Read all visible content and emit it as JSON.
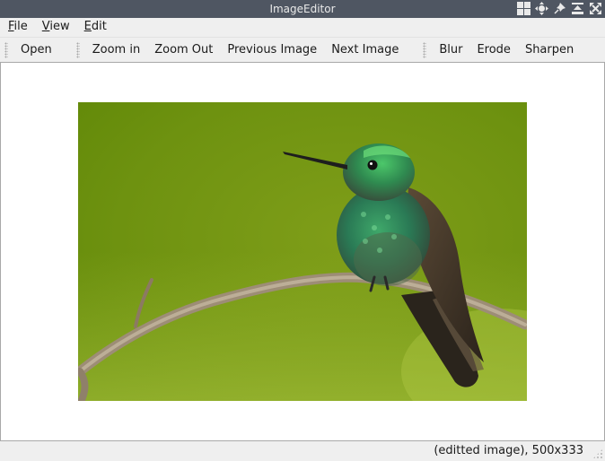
{
  "window": {
    "title": "ImageEditor",
    "title_icons": [
      "tile-icon",
      "move-icon",
      "pin-icon",
      "minimize-icon",
      "close-icon"
    ]
  },
  "menubar": {
    "file": {
      "mnemonic": "F",
      "rest": "ile"
    },
    "view": {
      "mnemonic": "V",
      "rest": "iew"
    },
    "edit": {
      "mnemonic": "E",
      "rest": "dit"
    }
  },
  "toolbar": {
    "file_group": {
      "open": "Open"
    },
    "view_group": {
      "zoom_in": "Zoom in",
      "zoom_out": "Zoom Out",
      "previous_image": "Previous Image",
      "next_image": "Next Image"
    },
    "edit_group": {
      "blur": "Blur",
      "erode": "Erode",
      "sharpen": "Sharpen"
    }
  },
  "image": {
    "subject": "hummingbird-on-branch",
    "background_color": "#86a41a"
  },
  "statusbar": {
    "text": "(editted image), 500x333"
  },
  "colors": {
    "titlebar": "#4f5662",
    "window_bg": "#efefef",
    "canvas_bg": "#ffffff"
  }
}
